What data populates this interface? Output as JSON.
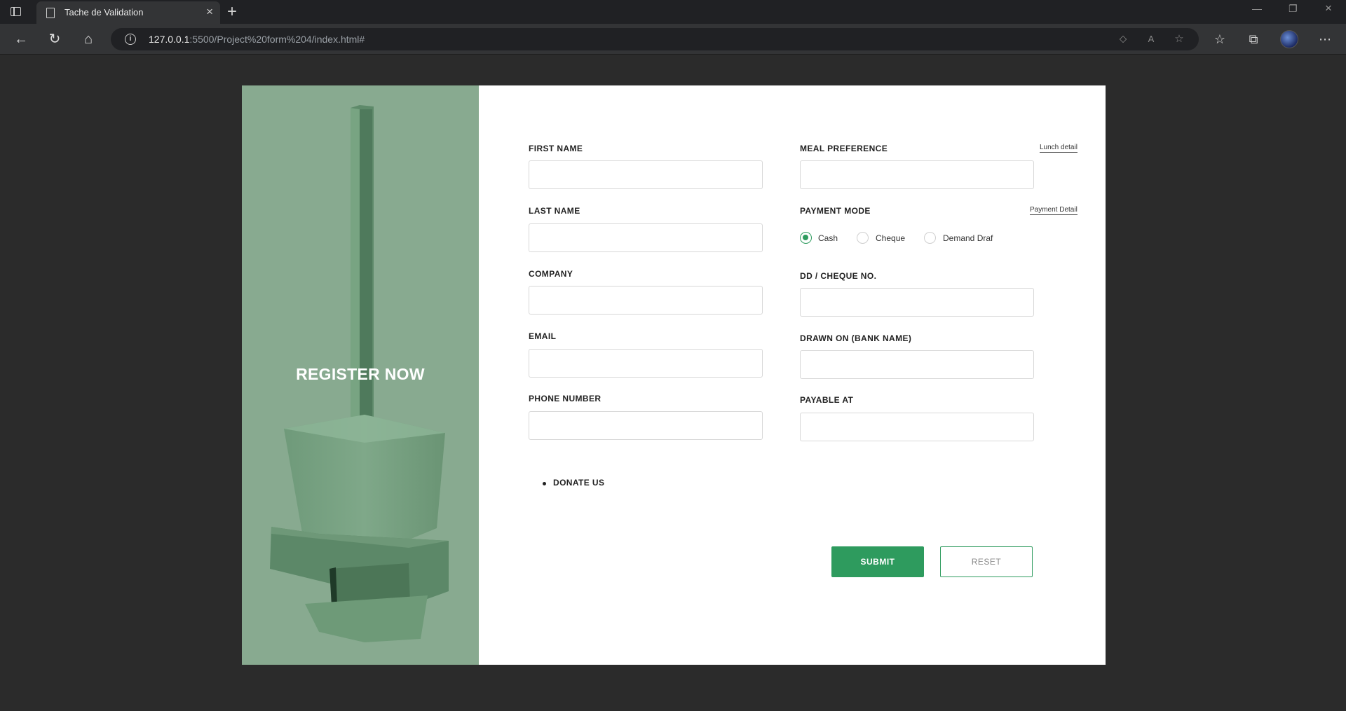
{
  "browser": {
    "tab_title": "Tache de Validation",
    "url_host": "127.0.0.1",
    "url_rest": ":5500/Project%20form%204/index.html#"
  },
  "hero": {
    "title": "REGISTER NOW",
    "background_color": "#88aa90"
  },
  "form": {
    "left": [
      {
        "label": "FIRST NAME",
        "value": ""
      },
      {
        "label": "LAST NAME",
        "value": ""
      },
      {
        "label": "COMPANY",
        "value": ""
      },
      {
        "label": "EMAIL",
        "value": ""
      },
      {
        "label": "PHONE NUMBER",
        "value": ""
      }
    ],
    "meal": {
      "label": "MEAL PREFERENCE",
      "link": "Lunch detail",
      "value": ""
    },
    "payment": {
      "label": "PAYMENT MODE",
      "link": "Payment Detail",
      "options": [
        "Cash",
        "Cheque",
        "Demand Draf"
      ],
      "selected": "Cash"
    },
    "right": [
      {
        "label": "DD / CHEQUE NO.",
        "value": ""
      },
      {
        "label": "DRAWN ON (BANK NAME)",
        "value": ""
      },
      {
        "label": "PAYABLE AT",
        "value": ""
      }
    ],
    "donate": "DONATE US",
    "submit_label": "SUBMIT",
    "reset_label": "RESET",
    "accent_color": "#2e9b5e"
  }
}
